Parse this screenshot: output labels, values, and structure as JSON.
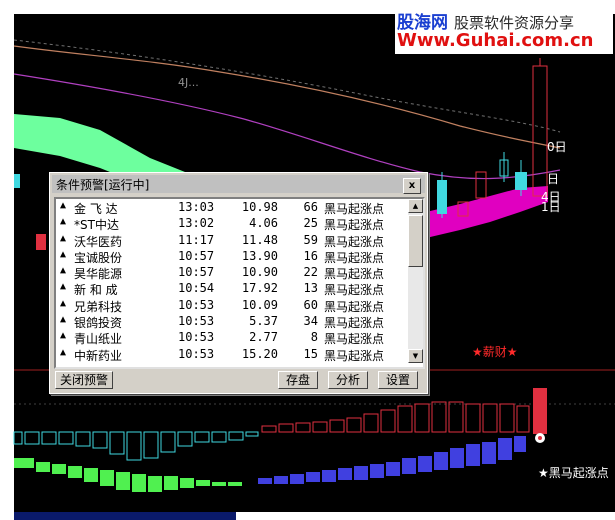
{
  "watermark": {
    "site_name": "股海网",
    "tagline": "股票软件资源分享",
    "url": "Www.Guhai.com.cn"
  },
  "chart": {
    "axis_label_0": "0日",
    "axis_label_1": "日",
    "axis_label_2": "4日",
    "axis_label_3": "1日",
    "top_label": "4J...",
    "star_signal_1": "★薪财★",
    "star_signal_2": "★黑马起涨点",
    "colors": {
      "background": "#000000",
      "ribbon_green": "#6dff9e",
      "ribbon_magenta": "#e000c0",
      "line_orange": "#d08a6a",
      "line_purple": "#c040d0",
      "line_gray": "#8a8a8a",
      "cyan_candle": "#40d8e0",
      "red_bar": "#e03040",
      "blue_bar": "#4040e0",
      "green_bar": "#50f050"
    }
  },
  "dialog": {
    "title": "条件预警[运行中]",
    "close_label": "x",
    "rows": [
      {
        "name": "金 飞 达",
        "time": "13:03",
        "price": "10.98",
        "value": "66",
        "signal": "黑马起涨点"
      },
      {
        "name": "*ST中达",
        "time": "13:02",
        "price": "4.06",
        "value": "25",
        "signal": "黑马起涨点"
      },
      {
        "name": "沃华医药",
        "time": "11:17",
        "price": "11.48",
        "value": "59",
        "signal": "黑马起涨点"
      },
      {
        "name": "宝诚股份",
        "time": "10:57",
        "price": "13.90",
        "value": "16",
        "signal": "黑马起涨点"
      },
      {
        "name": "昊华能源",
        "time": "10:57",
        "price": "10.90",
        "value": "22",
        "signal": "黑马起涨点"
      },
      {
        "name": "新 和 成",
        "time": "10:54",
        "price": "17.92",
        "value": "13",
        "signal": "黑马起涨点"
      },
      {
        "name": "兄弟科技",
        "time": "10:53",
        "price": "10.09",
        "value": "60",
        "signal": "黑马起涨点"
      },
      {
        "name": "银鸽投资",
        "time": "10:53",
        "price": "5.37",
        "value": "34",
        "signal": "黑马起涨点"
      },
      {
        "name": "青山纸业",
        "time": "10:53",
        "price": "2.77",
        "value": "8",
        "signal": "黑马起涨点"
      },
      {
        "name": "中新药业",
        "time": "10:53",
        "price": "15.20",
        "value": "15",
        "signal": "黑马起涨点"
      }
    ],
    "buttons": {
      "close_alert": "关闭预警",
      "save": "存盘",
      "analyze": "分析",
      "settings": "设置"
    }
  }
}
